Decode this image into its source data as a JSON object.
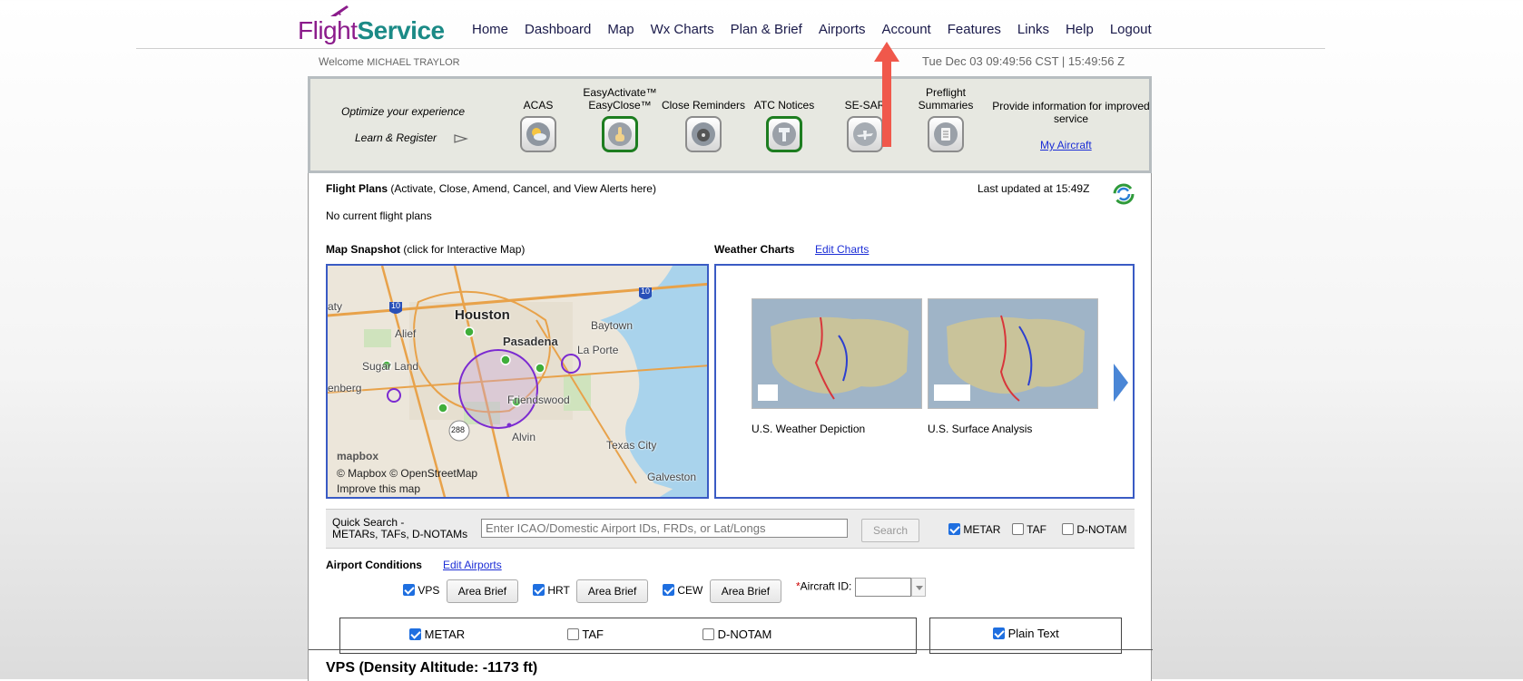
{
  "app": {
    "brand_part1": "Flight",
    "brand_part2": "Service"
  },
  "nav": {
    "items": [
      "Home",
      "Dashboard",
      "Map",
      "Wx Charts",
      "Plan & Brief",
      "Airports",
      "Account",
      "Features",
      "Links",
      "Help",
      "Logout"
    ]
  },
  "header": {
    "welcome_prefix": "Welcome",
    "user_name": "MICHAEL TRAYLOR",
    "datetime": "Tue Dec 03 09:49:56 CST | 15:49:56 Z"
  },
  "features": {
    "optimize": "Optimize your experience",
    "learn": "Learn & Register",
    "items": [
      {
        "label": "ACAS",
        "icon": "weather-sun-icon",
        "active": false
      },
      {
        "label": "EasyActivate™ EasyClose™",
        "icon": "hand-pointer-icon",
        "active": true
      },
      {
        "label": "Close Reminders",
        "icon": "reminder-disc-icon",
        "active": false
      },
      {
        "label": "ATC Notices",
        "icon": "control-tower-icon",
        "active": true
      },
      {
        "label": "SE-SAR",
        "icon": "search-rescue-plane-icon",
        "active": false
      },
      {
        "label": "Preflight Summaries",
        "icon": "clipboard-icon",
        "active": false
      }
    ],
    "provide_text": "Provide information for improved service",
    "my_aircraft": "My Aircraft"
  },
  "flight_plans": {
    "title": "Flight Plans",
    "subtitle": "(Activate, Close, Amend, Cancel, and View Alerts here)",
    "last_updated": "Last updated at 15:49Z",
    "empty_text": "No current flight plans"
  },
  "map": {
    "title": "Map Snapshot",
    "subtitle": "(click for Interactive Map)",
    "labels": {
      "houston": "Houston",
      "pasadena": "Pasadena",
      "baytown": "Baytown",
      "la_porte": "La Porte",
      "alief": "Alief",
      "sugar_land": "Sugar Land",
      "friendswood": "Friendswood",
      "alvin": "Alvin",
      "texas_city": "Texas City",
      "galveston": "Galveston",
      "katy": "aty",
      "rosenberg": "enberg",
      "i10_west": "10",
      "i10_east": "10",
      "hwy288": "288"
    },
    "logo": "mapbox",
    "credit": "© Mapbox © OpenStreetMap",
    "improve": "Improve this map"
  },
  "weather": {
    "title": "Weather Charts",
    "edit_link": "Edit Charts",
    "charts": [
      {
        "caption": "U.S. Weather Depiction"
      },
      {
        "caption": "U.S. Surface Analysis"
      }
    ]
  },
  "quick_search": {
    "label_line1": "Quick Search -",
    "label_line2": "METARs, TAFs, D-NOTAMs",
    "placeholder": "Enter ICAO/Domestic Airport IDs, FRDs, or Lat/Longs",
    "button": "Search",
    "options": [
      {
        "label": "METAR",
        "checked": true
      },
      {
        "label": "TAF",
        "checked": false
      },
      {
        "label": "D-NOTAM",
        "checked": false
      }
    ]
  },
  "airport_conditions": {
    "title": "Airport Conditions",
    "edit_link": "Edit Airports",
    "airports": [
      {
        "id": "VPS",
        "checked": true,
        "button": "Area Brief"
      },
      {
        "id": "HRT",
        "checked": true,
        "button": "Area Brief"
      },
      {
        "id": "CEW",
        "checked": true,
        "button": "Area Brief"
      }
    ],
    "aircraft_id_required": "*",
    "aircraft_id_label": "Aircraft ID:",
    "report_options": [
      {
        "label": "METAR",
        "checked": true
      },
      {
        "label": "TAF",
        "checked": false
      },
      {
        "label": "D-NOTAM",
        "checked": false
      }
    ],
    "plain_text": {
      "label": "Plain Text",
      "checked": true
    },
    "vps_heading": "VPS (Density Altitude: -1173 ft)"
  },
  "colors": {
    "brand_purple": "#8b1b8b",
    "brand_teal": "#1b8a86",
    "link_blue": "#1c2ed6",
    "active_green": "#1d7d20",
    "annotation_red": "#f0584b",
    "map_border": "#3a5bc4"
  }
}
